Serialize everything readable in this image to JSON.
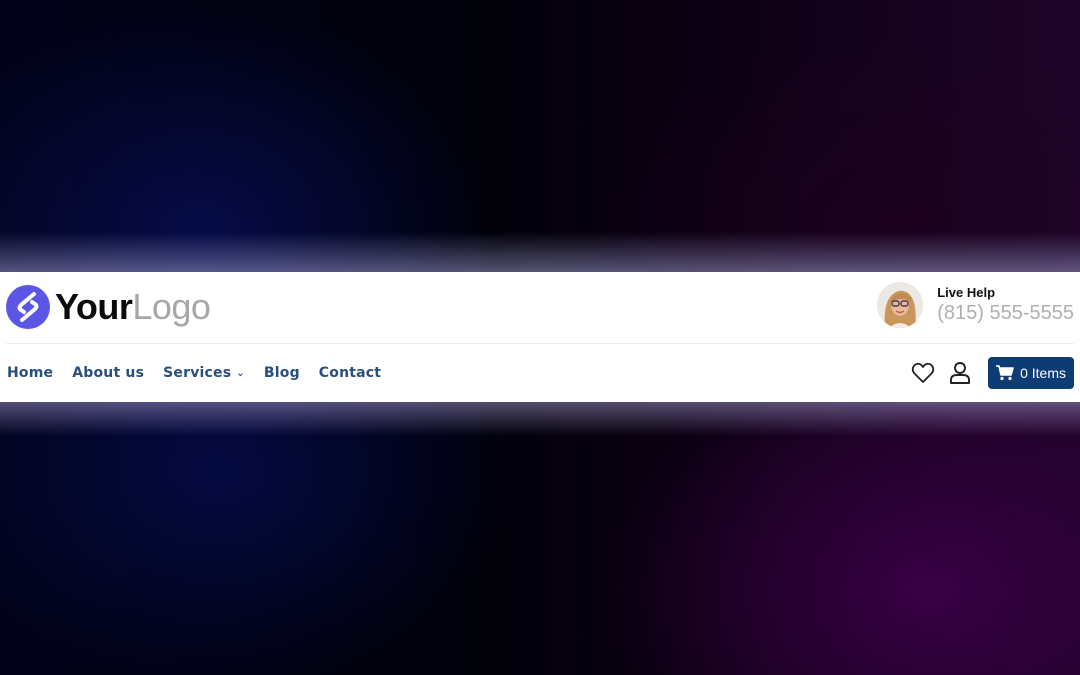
{
  "logo": {
    "part1": "Your",
    "part2": "Logo",
    "icon": "logo-mark-icon",
    "brand_color": "#5b56e6"
  },
  "help": {
    "label": "Live Help",
    "phone": "(815) 555-5555",
    "avatar": "support-agent-avatar"
  },
  "nav": {
    "items": [
      {
        "label": "Home"
      },
      {
        "label": "About us"
      },
      {
        "label": "Services",
        "has_dropdown": true,
        "dropdown_icon": "chevron-down-icon"
      },
      {
        "label": "Blog"
      },
      {
        "label": "Contact"
      }
    ]
  },
  "actions": {
    "wishlist_icon": "heart-icon",
    "account_icon": "user-icon",
    "cart": {
      "icon": "cart-icon",
      "label": "0 Items",
      "color": "#0d3b74"
    }
  },
  "colors": {
    "nav_text": "#2a4f7e",
    "background_left": "#040a46",
    "background_right": "#3a0046"
  }
}
